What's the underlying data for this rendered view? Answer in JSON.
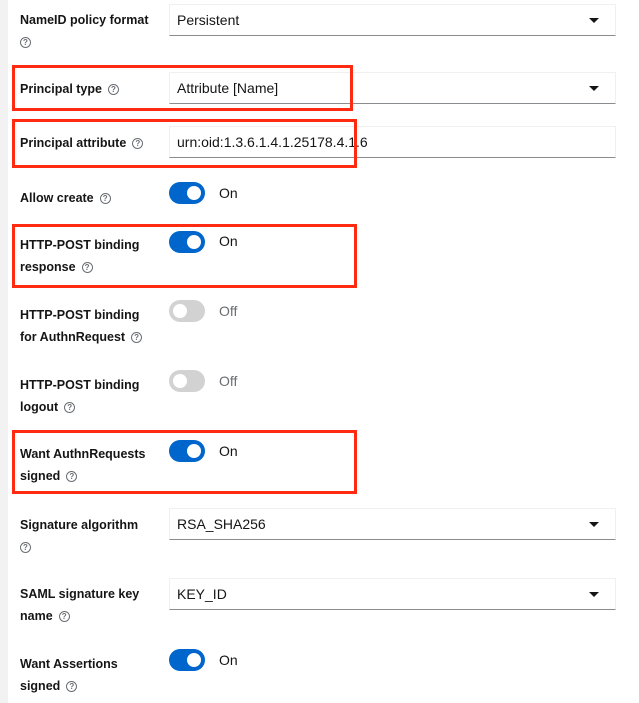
{
  "fields": {
    "nameid": {
      "label": "NameID policy format",
      "value": "Persistent"
    },
    "principal_type": {
      "label": "Principal type",
      "value": "Attribute [Name]"
    },
    "principal_attribute": {
      "label": "Principal attribute",
      "value": "urn:oid:1.3.6.1.4.1.25178.4.1.6"
    },
    "allow_create": {
      "label": "Allow create",
      "state": "On",
      "on": true
    },
    "post_response": {
      "label_1": "HTTP-POST binding",
      "label_2": "response",
      "state": "On",
      "on": true
    },
    "post_authn": {
      "label_1": "HTTP-POST binding",
      "label_2": "for AuthnRequest",
      "state": "Off",
      "on": false
    },
    "post_logout": {
      "label_1": "HTTP-POST binding",
      "label_2": "logout",
      "state": "Off",
      "on": false
    },
    "want_authn_signed": {
      "label_1": "Want AuthnRequests",
      "label_2": "signed",
      "state": "On",
      "on": true
    },
    "sig_alg": {
      "label": "Signature algorithm",
      "value": "RSA_SHA256"
    },
    "key_name": {
      "label_1": "SAML signature key",
      "label_2": "name",
      "value": "KEY_ID"
    },
    "want_assert_signed": {
      "label_1": "Want Assertions",
      "label_2": "signed",
      "state": "On",
      "on": true
    }
  },
  "help_glyph": "?",
  "colors": {
    "accent": "#0066cc",
    "highlight": "#ff2a12",
    "toggle_off": "#d2d2d2"
  }
}
